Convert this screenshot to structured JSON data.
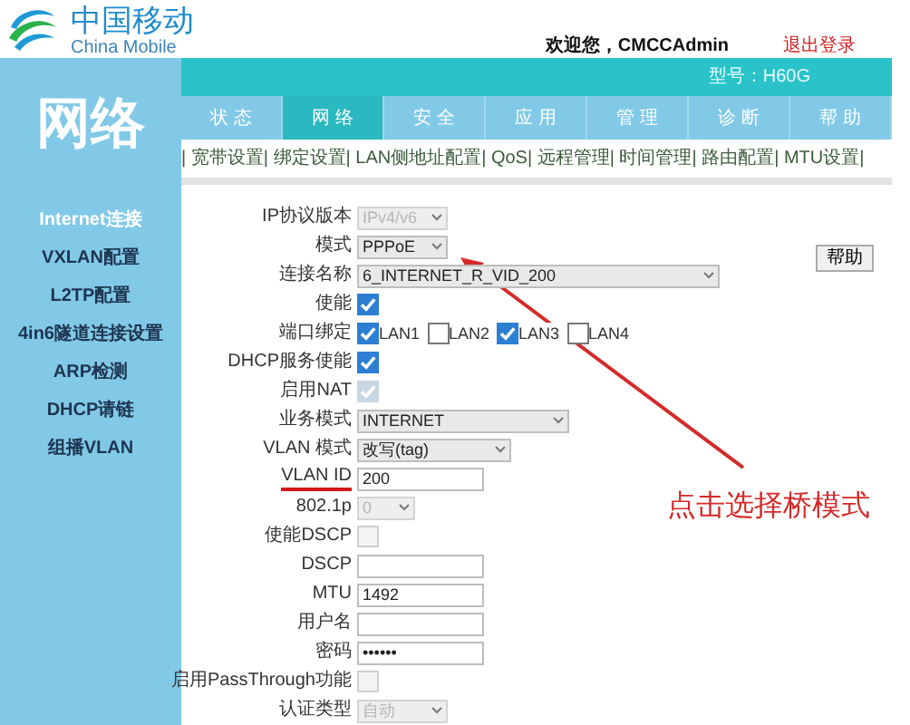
{
  "header": {
    "logo_cn": "中国移动",
    "logo_en": "China Mobile",
    "welcome": "欢迎您，CMCCAdmin",
    "logout": "退出登录",
    "model": "型号：H60G"
  },
  "section_title": "网络",
  "tabs": [
    {
      "label": "状 态",
      "selected": false
    },
    {
      "label": "网 络",
      "selected": true
    },
    {
      "label": "安 全",
      "selected": false
    },
    {
      "label": "应 用",
      "selected": false
    },
    {
      "label": "管 理",
      "selected": false
    },
    {
      "label": "诊 断",
      "selected": false
    },
    {
      "label": "帮 助",
      "selected": false
    }
  ],
  "subnav": "| 宽带设置| 绑定设置| LAN侧地址配置| QoS| 远程管理| 时间管理| 路由配置| MTU设置|",
  "sidebar": {
    "items": [
      {
        "label": "Internet连接",
        "selected": true
      },
      {
        "label": "VXLAN配置",
        "selected": false
      },
      {
        "label": "L2TP配置",
        "selected": false
      },
      {
        "label": "4in6隧道连接设置",
        "selected": false
      },
      {
        "label": "ARP检测",
        "selected": false
      },
      {
        "label": "DHCP请链",
        "selected": false
      },
      {
        "label": "组播VLAN",
        "selected": false
      }
    ]
  },
  "form": {
    "rows": [
      {
        "label": "IP协议版本",
        "kind": "select",
        "value": "IPv4/v6",
        "disabled": true
      },
      {
        "label": "模式",
        "kind": "select",
        "value": "PPPoE",
        "disabled": false
      },
      {
        "label": "连接名称",
        "kind": "select",
        "value": "6_INTERNET_R_VID_200",
        "disabled": false
      },
      {
        "label": "使能",
        "kind": "checkbox",
        "checked": true,
        "disabled": false
      },
      {
        "label": "端口绑定",
        "kind": "ports",
        "ports": [
          {
            "label": "LAN1",
            "checked": true
          },
          {
            "label": "LAN2",
            "checked": false
          },
          {
            "label": "LAN3",
            "checked": true
          },
          {
            "label": "LAN4",
            "checked": false
          }
        ]
      },
      {
        "label": "DHCP服务使能",
        "kind": "checkbox",
        "checked": true,
        "disabled": false
      },
      {
        "label": "启用NAT",
        "kind": "checkbox",
        "checked": true,
        "disabled": true
      },
      {
        "label": "业务模式",
        "kind": "select",
        "value": "INTERNET",
        "disabled": false
      },
      {
        "label": "VLAN 模式",
        "kind": "select",
        "value": "改写(tag)",
        "disabled": false
      },
      {
        "label": "VLAN ID",
        "kind": "text",
        "value": "200",
        "underlined": true
      },
      {
        "label": "802.1p",
        "kind": "select",
        "value": "0",
        "disabled": true
      },
      {
        "label": "使能DSCP",
        "kind": "checkbox",
        "checked": false,
        "disabled": true
      },
      {
        "label": "DSCP",
        "kind": "text",
        "value": "",
        "underlined": false
      },
      {
        "label": "MTU",
        "kind": "text",
        "value": "1492",
        "underlined": false
      },
      {
        "label": "用户名",
        "kind": "text",
        "value": "",
        "underlined": false
      },
      {
        "label": "密码",
        "kind": "text",
        "value": "••••••",
        "underlined": false
      },
      {
        "label": "启用PassThrough功能",
        "kind": "checkbox",
        "checked": false,
        "disabled": true
      },
      {
        "label": "认证类型",
        "kind": "select",
        "value": "自动",
        "disabled": true
      }
    ]
  },
  "help_button": "帮助",
  "annotation": "点击选择桥模式"
}
